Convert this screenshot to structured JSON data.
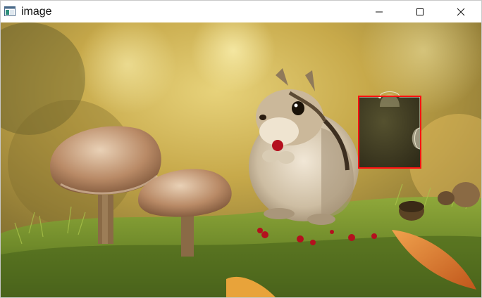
{
  "window": {
    "title": "image",
    "title_icon": "app-window-icon"
  },
  "controls": {
    "minimize_icon": "minimize-icon",
    "maximize_icon": "maximize-icon",
    "close_icon": "close-icon"
  },
  "canvas": {
    "content": "photo-chipmunk-mushrooms",
    "overlay": {
      "type": "puzzle-captcha-piece",
      "box_color": "#ff1111"
    }
  }
}
